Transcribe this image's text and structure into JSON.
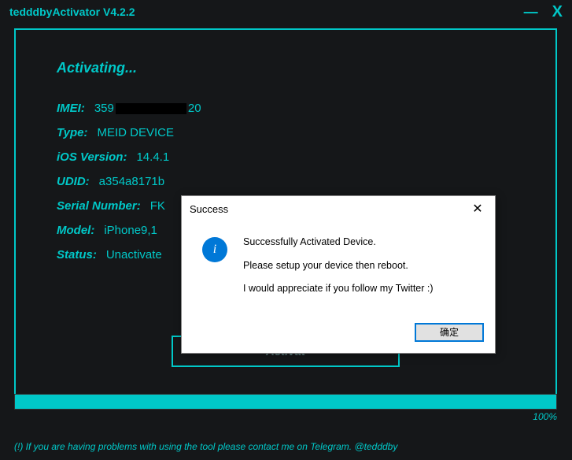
{
  "titlebar": {
    "title": "tedddbyActivator V4.2.2"
  },
  "main": {
    "header": "Activating...",
    "info": {
      "imei_label": "IMEI:",
      "imei_prefix": "359",
      "imei_suffix": "20",
      "type_label": "Type:",
      "type_value": "MEID DEVICE",
      "ios_label": "iOS Version:",
      "ios_value": "14.4.1",
      "udid_label": "UDID:",
      "udid_value": "a354a8171b",
      "serial_label": "Serial Number:",
      "serial_value": "FK",
      "model_label": "Model:",
      "model_value": "iPhone9,1",
      "status_label": "Status:",
      "status_value": "Unactivate"
    },
    "button_activate": "Activat"
  },
  "progress": {
    "percent_text": "100%"
  },
  "footer": {
    "note": "(!) If you are having problems with using the tool please contact me on Telegram. @tedddby"
  },
  "dialog": {
    "title": "Success",
    "msg1": "Successfully Activated Device.",
    "msg2": "Please setup your device then reboot.",
    "msg3": "I would appreciate if you follow my Twitter :)",
    "ok": "确定"
  }
}
